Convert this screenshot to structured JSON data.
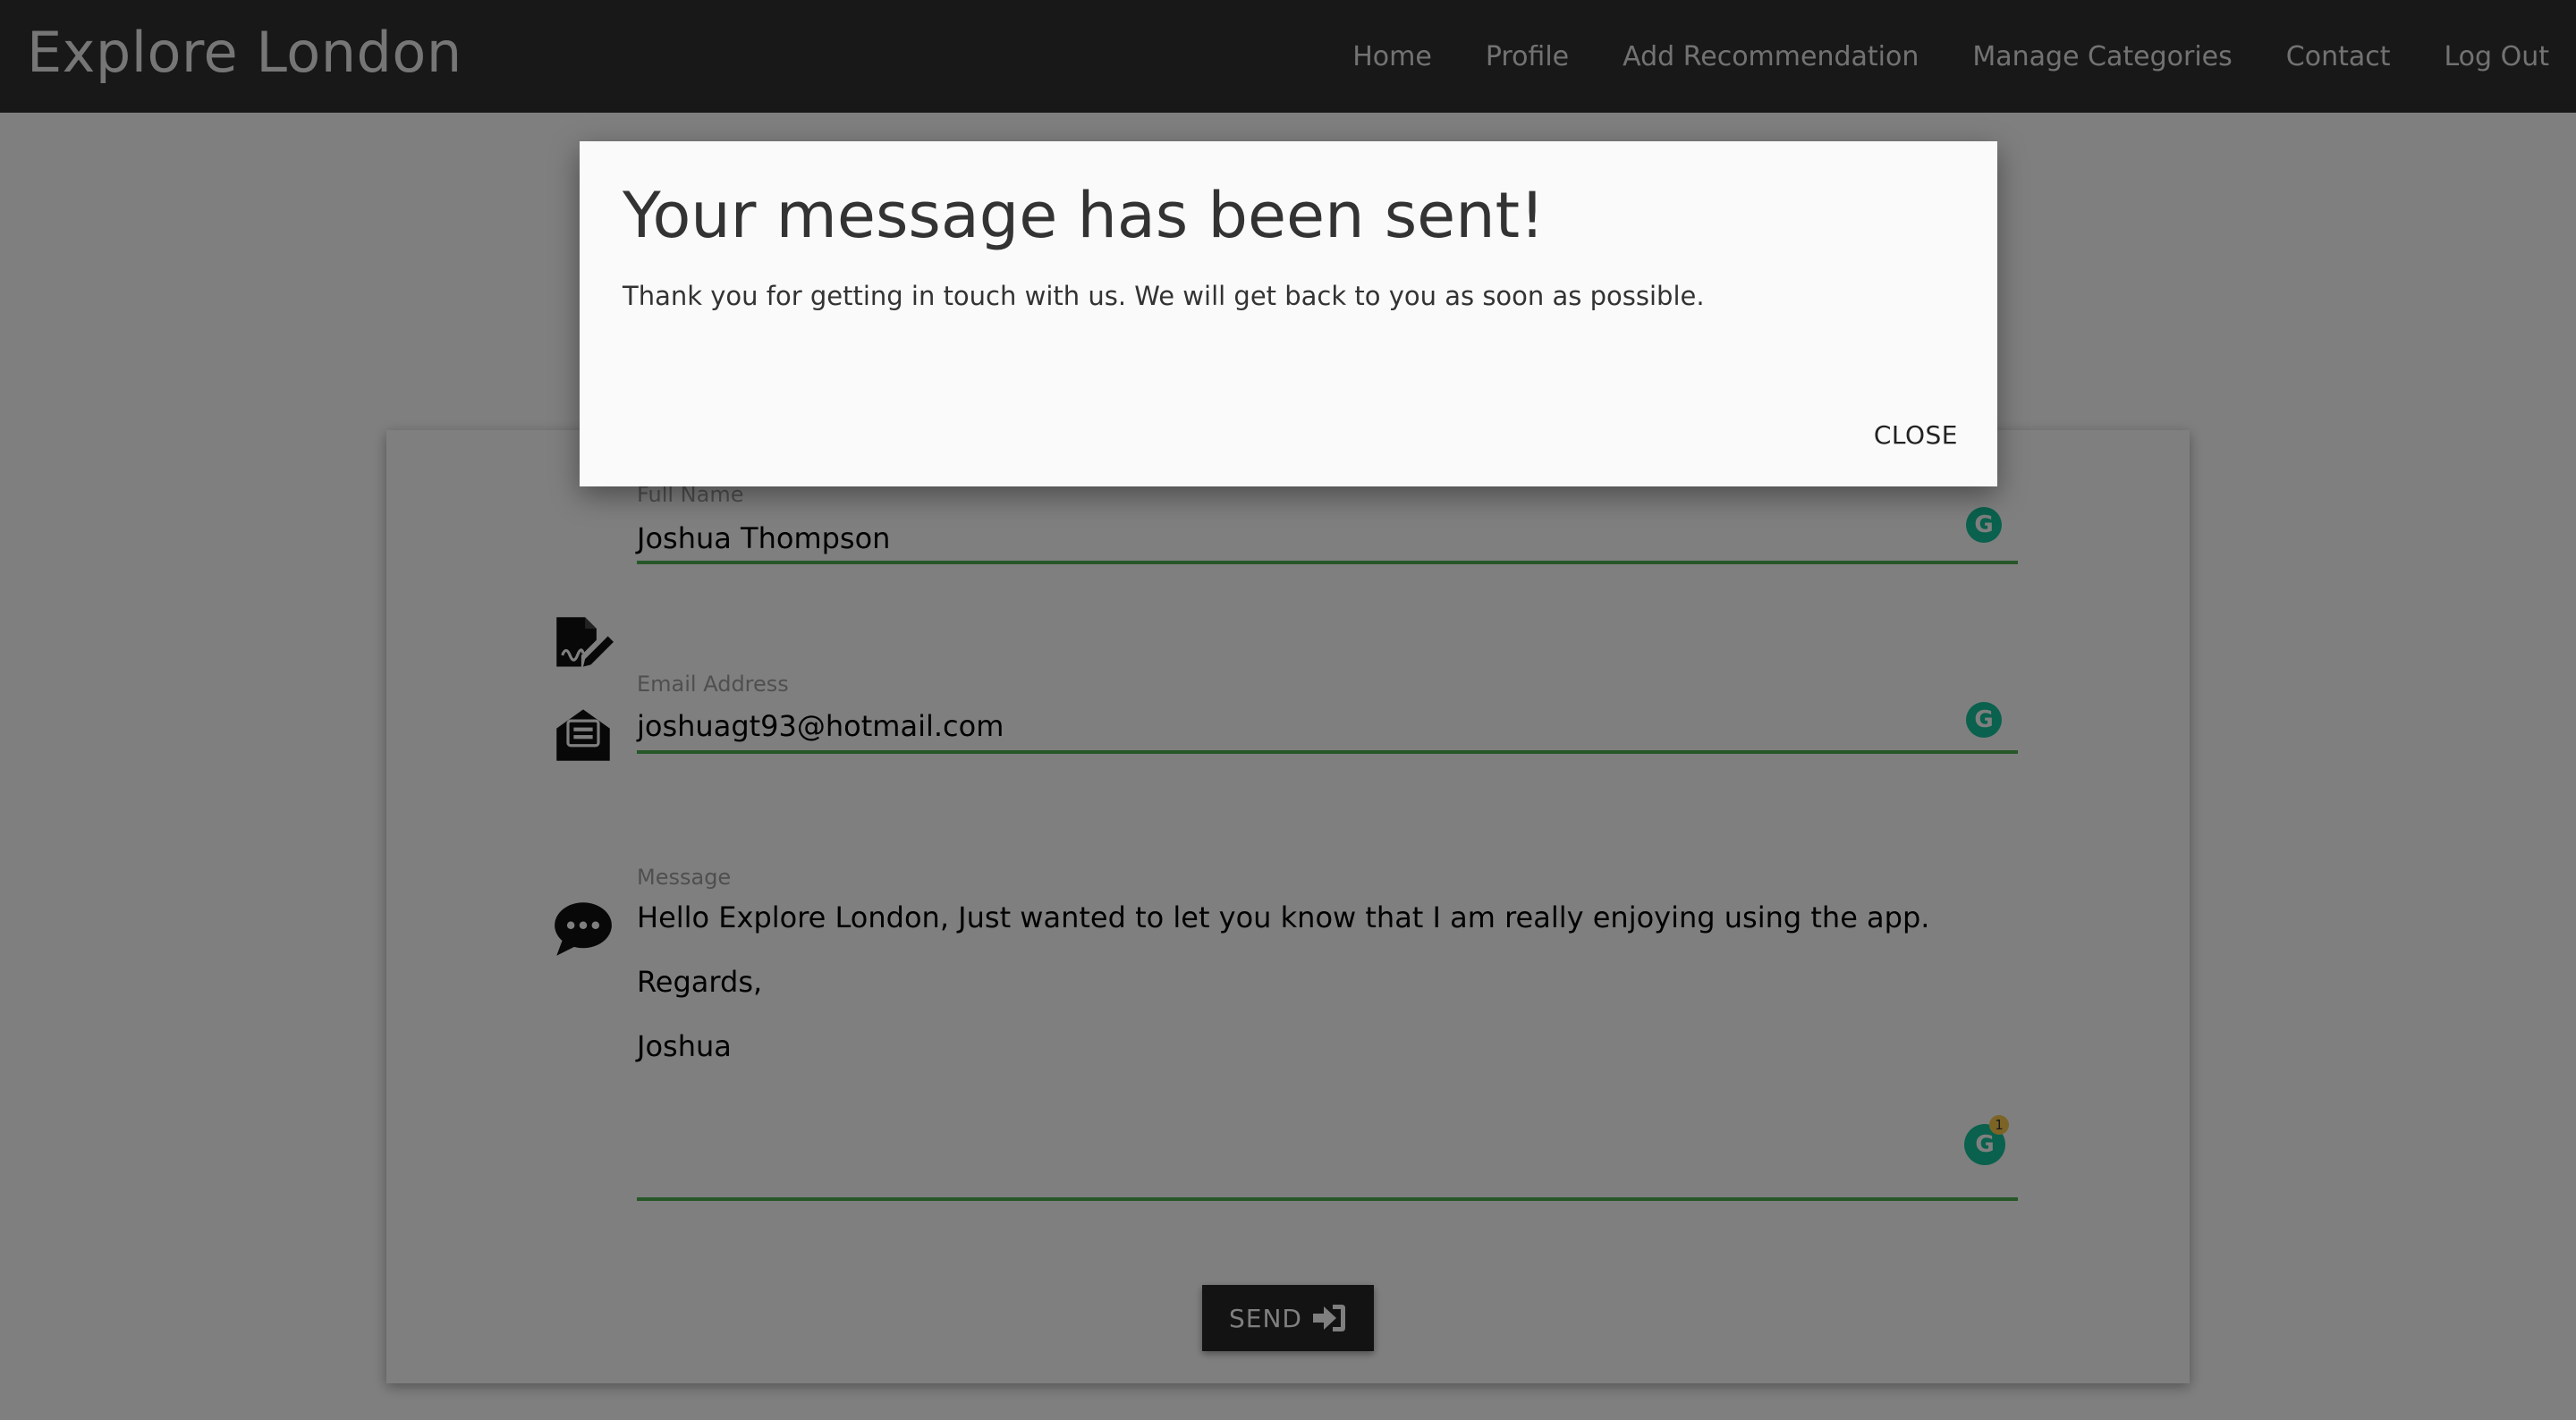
{
  "app": {
    "title": "Explore London"
  },
  "nav": {
    "items": [
      "Home",
      "Profile",
      "Add Recommendation",
      "Manage Categories",
      "Contact",
      "Log Out"
    ]
  },
  "form": {
    "full_name": {
      "label": "Full Name",
      "value": "Joshua Thompson",
      "icon": "signature-icon"
    },
    "email": {
      "label": "Email Address",
      "value": "joshuagt93@hotmail.com",
      "icon": "envelope-open-icon"
    },
    "message": {
      "label": "Message",
      "lines": [
        "Hello Explore London, Just wanted to let you know that I am really enjoying using the app.",
        "Regards,",
        "Joshua"
      ],
      "icon": "comment-dots-icon"
    },
    "grammar_badge": {
      "letter": "G",
      "count": "1",
      "color": "#15c39a"
    },
    "send_label": "SEND"
  },
  "modal": {
    "title": "Your message has been sent!",
    "text": "Thank you for getting in touch with us. We will get back to you as soon as possible.",
    "close_label": "CLOSE"
  },
  "colors": {
    "navbar": "#313131",
    "underline": "#4caf50",
    "button": "#262626"
  }
}
